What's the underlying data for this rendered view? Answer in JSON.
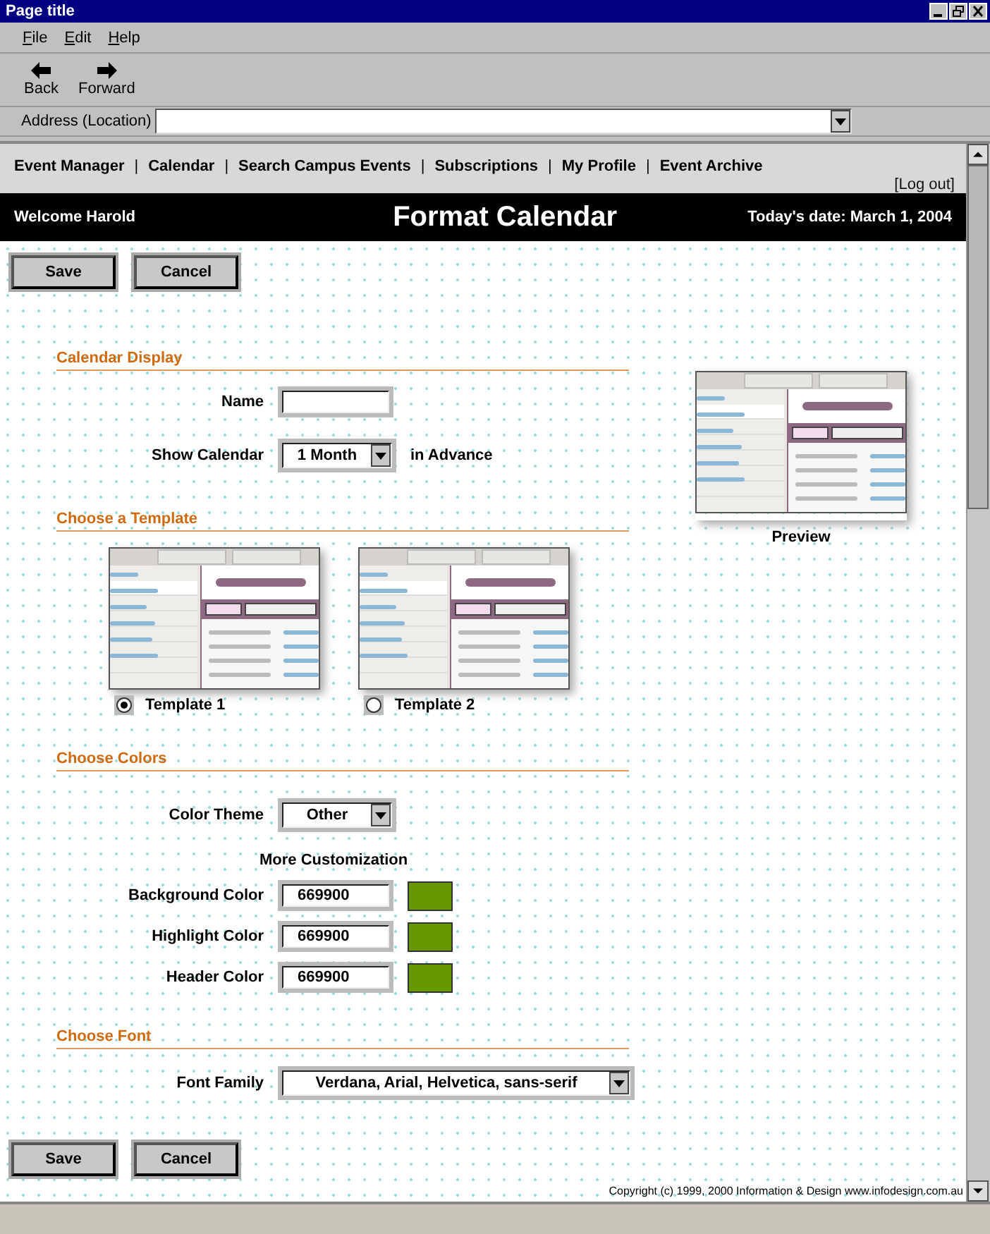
{
  "window": {
    "title": "Page title"
  },
  "menu": [
    "File",
    "Edit",
    "Help"
  ],
  "toolbar": [
    {
      "kind": "back",
      "label": "Back"
    },
    {
      "kind": "forward",
      "label": "Forward"
    }
  ],
  "address": {
    "label": "Address (Location)"
  },
  "nav": {
    "items": [
      {
        "kind": "link",
        "text": "Event Manager"
      },
      {
        "kind": "separator",
        "text": "|"
      },
      {
        "kind": "link",
        "text": "Calendar"
      },
      {
        "kind": "separator",
        "text": "|"
      },
      {
        "kind": "link",
        "text": "Search Campus Events"
      },
      {
        "kind": "separator",
        "text": "|"
      },
      {
        "kind": "link",
        "text": "Subscriptions"
      },
      {
        "kind": "separator",
        "text": "|"
      },
      {
        "kind": "link",
        "text": "My Profile"
      },
      {
        "kind": "separator",
        "text": "|"
      },
      {
        "kind": "link",
        "text": "Event Archive"
      }
    ],
    "logout": "[Log out]"
  },
  "header": {
    "welcome": "Welcome Harold",
    "title": "Format Calendar",
    "date": "Today's date: March 1, 2004"
  },
  "top_buttons": [
    "Save",
    "Cancel"
  ],
  "calendar_display": {
    "heading": "Calendar Display",
    "name_label": "Name",
    "show_label": "Show Calendar",
    "show_value": "1 Month",
    "show_suffix": "in Advance"
  },
  "template": {
    "heading": "Choose a Template",
    "options": [
      {
        "label": "Template 1",
        "selected": true
      },
      {
        "label": "Template 2",
        "selected": false
      }
    ]
  },
  "colors": {
    "heading": "Choose Colors",
    "theme_label": "Color Theme",
    "theme_value": "Other",
    "subheading": "More Customization",
    "fields": [
      {
        "label": "Background Color",
        "value": "669900",
        "color": "#669900"
      },
      {
        "label": "Highlight Color",
        "value": "669900",
        "color": "#669900"
      },
      {
        "label": "Header Color",
        "value": "669900",
        "color": "#669900"
      }
    ]
  },
  "font": {
    "heading": "Choose Font",
    "label": "Font Family",
    "value": "Verdana, Arial, Helvetica, sans-serif"
  },
  "preview": {
    "label": "Preview"
  },
  "bottom_buttons": [
    "Save",
    "Cancel"
  ],
  "copyright": "Copyright (c) 1999, 2000 Information & Design www.infodesign.com.au"
}
